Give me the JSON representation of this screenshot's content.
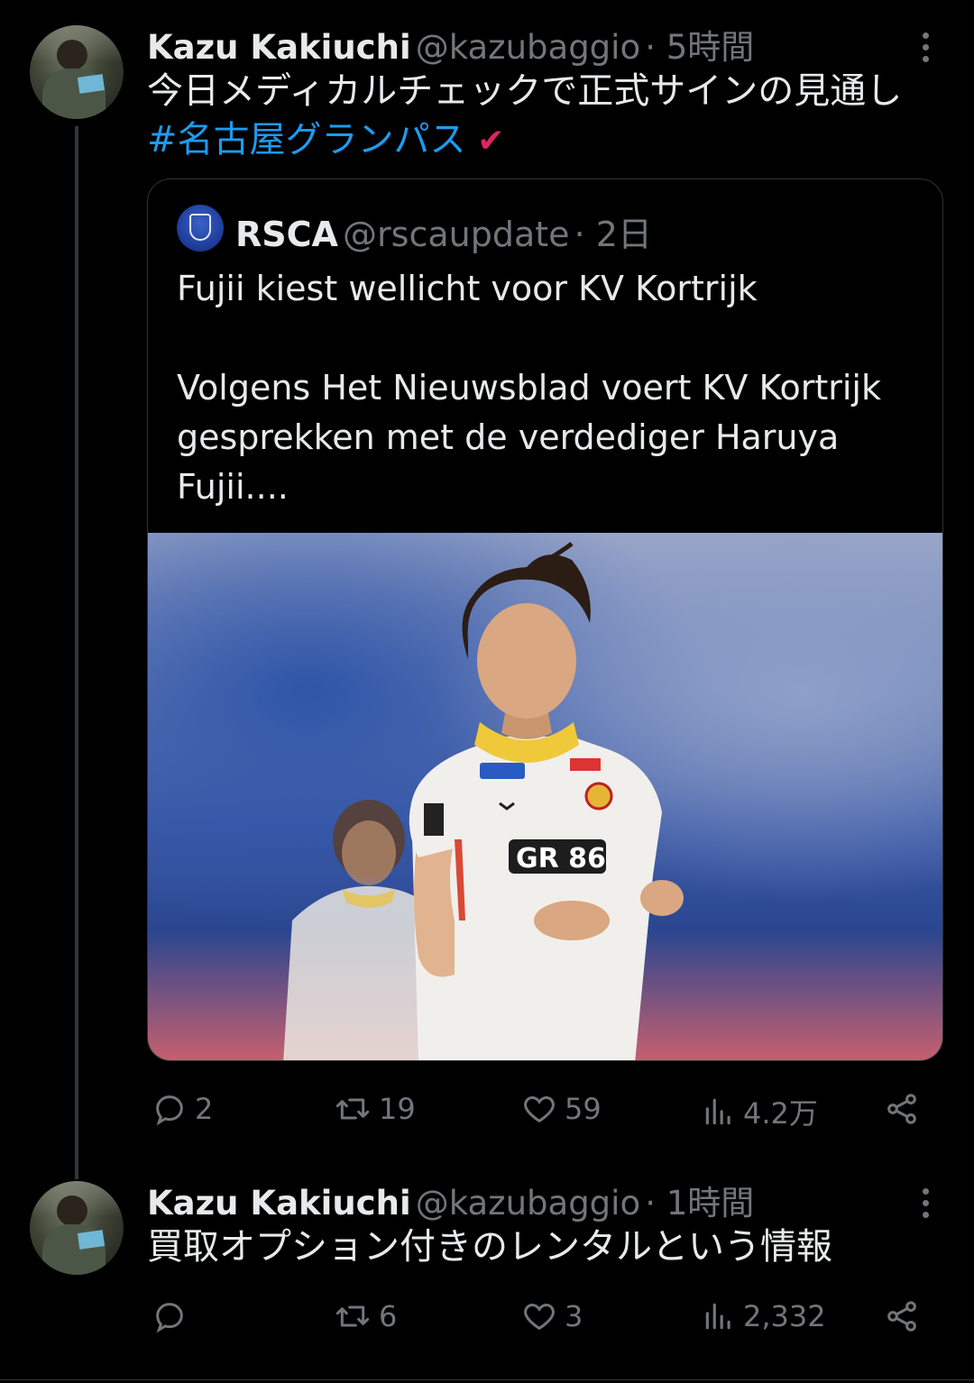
{
  "tweet1": {
    "author": "Kazu Kakiuchi",
    "handle": "@kazubaggio",
    "time": "· 5時間",
    "text_line1": "今日メディカルチェックで正式サインの見通し",
    "hashtag": "#名古屋グランパス",
    "emoji": "✔",
    "quote": {
      "author": "RSCA",
      "handle": "@rscaupdate",
      "time": "· 2日",
      "line1": "Fujii kiest wellicht voor KV Kortrijk",
      "line2": "Volgens Het Nieuwsblad voert KV Kortrijk",
      "line3": "gesprekken met de verdediger Haruya",
      "line4": "Fujii...."
    },
    "actions": {
      "replies": "2",
      "retweets": "19",
      "likes": "59",
      "views": "4.2万"
    }
  },
  "tweet2": {
    "author": "Kazu Kakiuchi",
    "handle": "@kazubaggio",
    "time": "· 1時間",
    "text": "買取オプション付きのレンタルという情報",
    "actions": {
      "replies": "",
      "retweets": "6",
      "likes": "3",
      "views": "2,332"
    }
  },
  "colors": {
    "background": "#000000",
    "text": "#e7e9ea",
    "secondary": "#71767b",
    "link": "#1d9bf0",
    "border": "#2f3336"
  }
}
